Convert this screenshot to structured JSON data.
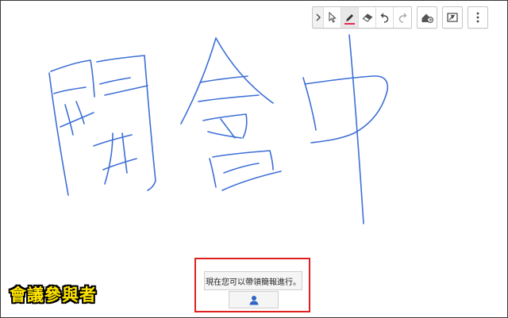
{
  "toolbar": {
    "tools": [
      {
        "id": "expand",
        "icon": "chevron-right-icon"
      },
      {
        "id": "select",
        "icon": "cursor-arrow-icon"
      },
      {
        "id": "pen",
        "icon": "pen-icon",
        "active": true
      },
      {
        "id": "eraser",
        "icon": "eraser-icon"
      },
      {
        "id": "undo",
        "icon": "undo-icon"
      },
      {
        "id": "redo",
        "icon": "redo-icon"
      }
    ],
    "extras": [
      {
        "id": "share",
        "icon": "share-board-icon"
      },
      {
        "id": "fullscreen",
        "icon": "fullscreen-icon"
      },
      {
        "id": "more",
        "icon": "more-vert-icon"
      }
    ]
  },
  "whiteboard": {
    "ink_color": "#3d6fd6",
    "highlight_color": "#e8294f"
  },
  "share_notice": {
    "message": "現在您可以帶領簡報進行。",
    "button_icon": "person-icon"
  },
  "caption": "會議參與者"
}
